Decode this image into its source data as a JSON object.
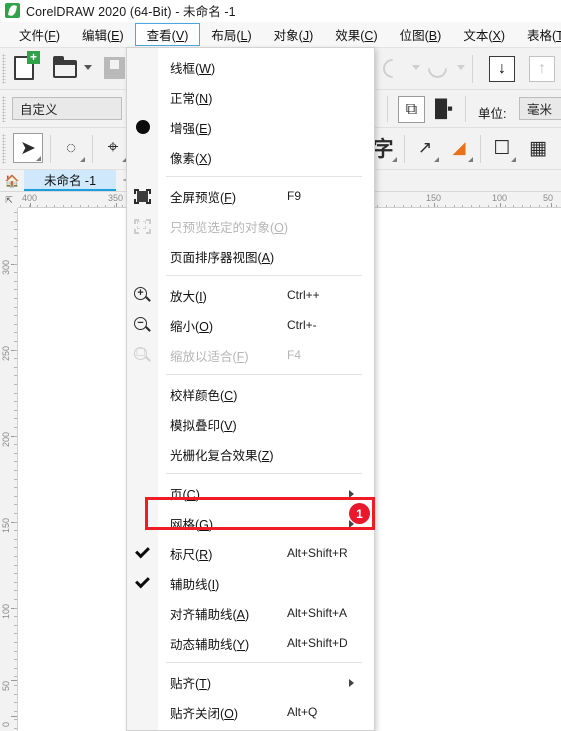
{
  "titlebar": {
    "icon": "coreldraw-logo-icon",
    "title": "CorelDRAW 2020 (64-Bit) - 未命名 -1"
  },
  "menubar": {
    "items": [
      {
        "label": "文件",
        "mnemonic": "F"
      },
      {
        "label": "编辑",
        "mnemonic": "E"
      },
      {
        "label": "查看",
        "mnemonic": "V",
        "active": true
      },
      {
        "label": "布局",
        "mnemonic": "L"
      },
      {
        "label": "对象",
        "mnemonic": "J"
      },
      {
        "label": "效果",
        "mnemonic": "C"
      },
      {
        "label": "位图",
        "mnemonic": "B"
      },
      {
        "label": "文本",
        "mnemonic": "X"
      },
      {
        "label": "表格",
        "mnemonic": "T"
      }
    ]
  },
  "toolbar": {
    "workspace_combo": "自定义",
    "units_label": "单位:",
    "units_value": "毫米"
  },
  "tabbar": {
    "home_icon": "home-icon",
    "document_tab": "未命名 -1",
    "add_tab": "+"
  },
  "rulers": {
    "horizontal_labels": [
      "400",
      "350",
      "150",
      "100",
      "50"
    ],
    "vertical_labels": [
      "300",
      "250",
      "200",
      "150",
      "100",
      "50",
      "0"
    ]
  },
  "view_menu": {
    "items": [
      {
        "label": "线框",
        "mnemonic": "W",
        "accel": "",
        "gutter": "",
        "sub": false,
        "disabled": false
      },
      {
        "label": "正常",
        "mnemonic": "N",
        "accel": "",
        "gutter": "",
        "sub": false,
        "disabled": false
      },
      {
        "label": "增强",
        "mnemonic": "E",
        "accel": "",
        "gutter": "radio-dot-icon",
        "sub": false,
        "disabled": false
      },
      {
        "label": "像素",
        "mnemonic": "X",
        "accel": "",
        "gutter": "",
        "sub": false,
        "disabled": false
      },
      {
        "separator": true
      },
      {
        "label": "全屏预览",
        "mnemonic": "F",
        "accel": "F9",
        "gutter": "full-screen-preview-icon",
        "sub": false,
        "disabled": false
      },
      {
        "label": "只预览选定的对象",
        "mnemonic": "O",
        "accel": "",
        "gutter": "preview-selected-icon",
        "sub": false,
        "disabled": true
      },
      {
        "label": "页面排序器视图",
        "mnemonic": "A",
        "accel": "",
        "gutter": "",
        "sub": false,
        "disabled": false
      },
      {
        "separator": true
      },
      {
        "label": "放大",
        "mnemonic": "I",
        "accel": "Ctrl++",
        "gutter": "zoom-in-icon",
        "sub": false,
        "disabled": false
      },
      {
        "label": "缩小",
        "mnemonic": "O",
        "accel": "Ctrl+-",
        "gutter": "zoom-out-icon",
        "sub": false,
        "disabled": false
      },
      {
        "label": "缩放以适合",
        "mnemonic": "F",
        "accel": "F4",
        "gutter": "zoom-to-fit-icon",
        "sub": false,
        "disabled": true
      },
      {
        "separator": true
      },
      {
        "label": "校样颜色",
        "mnemonic": "C",
        "accel": "",
        "gutter": "",
        "sub": false,
        "disabled": false
      },
      {
        "label": "模拟叠印",
        "mnemonic": "V",
        "accel": "",
        "gutter": "",
        "sub": false,
        "disabled": false
      },
      {
        "label": "光栅化复合效果",
        "mnemonic": "Z",
        "accel": "",
        "gutter": "",
        "sub": false,
        "disabled": false
      },
      {
        "separator": true
      },
      {
        "label": "页",
        "mnemonic": "C",
        "accel": "",
        "gutter": "",
        "sub": true,
        "disabled": false
      },
      {
        "label": "网格",
        "mnemonic": "G",
        "accel": "",
        "gutter": "",
        "sub": true,
        "disabled": false,
        "highlighted": true
      },
      {
        "label": "标尺",
        "mnemonic": "R",
        "accel": "Alt+Shift+R",
        "gutter": "checkmark-icon",
        "sub": false,
        "disabled": false
      },
      {
        "label": "辅助线",
        "mnemonic": "I",
        "accel": "",
        "gutter": "checkmark-icon",
        "sub": false,
        "disabled": false
      },
      {
        "label": "对齐辅助线",
        "mnemonic": "A",
        "accel": "Alt+Shift+A",
        "gutter": "",
        "sub": false,
        "disabled": false
      },
      {
        "label": "动态辅助线",
        "mnemonic": "Y",
        "accel": "Alt+Shift+D",
        "gutter": "",
        "sub": false,
        "disabled": false
      },
      {
        "separator": true
      },
      {
        "label": "贴齐",
        "mnemonic": "T",
        "accel": "",
        "gutter": "",
        "sub": true,
        "disabled": false
      },
      {
        "label": "贴齐关闭",
        "mnemonic": "O",
        "accel": "Alt+Q",
        "gutter": "",
        "sub": false,
        "disabled": false
      }
    ]
  },
  "annotation": {
    "badge_number": "1",
    "highlight_color": "#ef1c25",
    "badge_color": "#e8192c",
    "target": "网格(G)"
  }
}
